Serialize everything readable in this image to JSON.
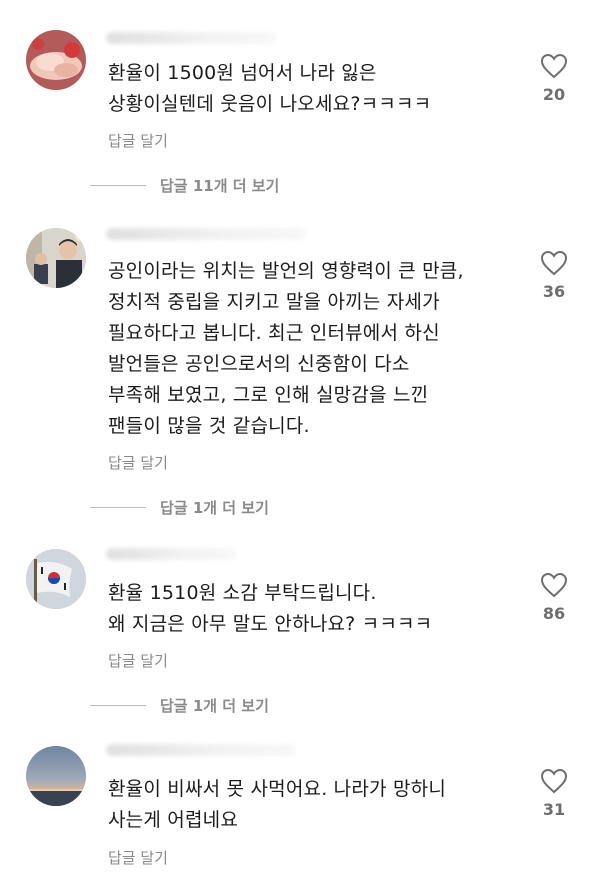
{
  "comments": [
    {
      "text": "환율이 1500원 넘어서 나라 잃은\n상황이실텐데 웃음이 나오세요?ㅋㅋㅋㅋ",
      "likes": "20",
      "reply_label": "답글 달기",
      "more_replies": "답글 11개 더 보기",
      "avatar_icon": "hands-avatar-icon"
    },
    {
      "text": "공인이라는 위치는 발언의 영향력이 큰 만큼,\n정치적 중립을 지키고 말을 아끼는 자세가\n필요하다고 봅니다. 최근 인터뷰에서 하신\n발언들은 공인으로서의 신중함이 다소\n부족해 보였고, 그로 인해 실망감을 느낀\n팬들이 많을 것 같습니다.",
      "likes": "36",
      "reply_label": "답글 달기",
      "more_replies": "답글 1개 더 보기",
      "avatar_icon": "person-avatar-icon"
    },
    {
      "text": "환율 1510원 소감 부탁드립니다.\n왜 지금은 아무 말도 안하나요? ㅋㅋㅋㅋ",
      "likes": "86",
      "reply_label": "답글 달기",
      "more_replies": "답글 1개 더 보기",
      "avatar_icon": "flag-avatar-icon"
    },
    {
      "text": "환율이 비싸서 못 사먹어요. 나라가 망하니\n사는게 어렵네요",
      "likes": "31",
      "reply_label": "답글 달기",
      "avatar_icon": "sunset-avatar-icon"
    }
  ],
  "colors": {
    "text": "#1c1c1c",
    "secondary": "#8a8a8a",
    "like_count": "#6e6e6e",
    "divider": "#bdbdbd"
  }
}
